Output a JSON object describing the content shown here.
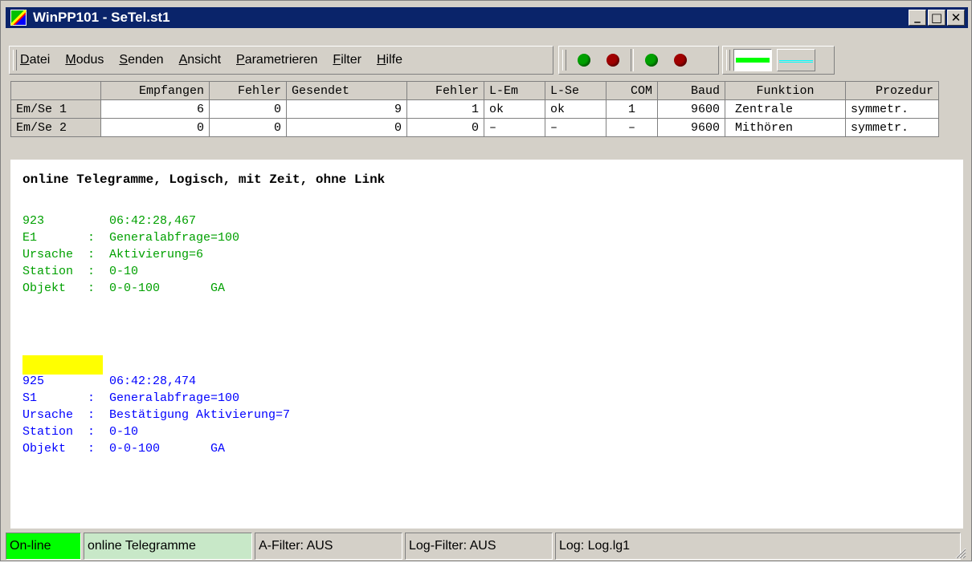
{
  "window": {
    "title": "WinPP101 - SeTel.st1",
    "buttons": [
      "_",
      "□",
      "✕"
    ]
  },
  "menu": {
    "items": [
      "Datei",
      "Modus",
      "Senden",
      "Ansicht",
      "Parametrieren",
      "Filter",
      "Hilfe"
    ]
  },
  "toolbar": {
    "leds": [
      "green",
      "red",
      "green",
      "red"
    ],
    "accent_colors": {
      "led_green": "#00a000",
      "led_red": "#a00000",
      "panel_green": "#00ff00",
      "panel_cyan": "#00ffff"
    }
  },
  "stats": {
    "headers": [
      "",
      "Empfangen",
      "Fehler",
      "Gesendet",
      "Fehler",
      "L-Em",
      "L-Se",
      "COM",
      "Baud",
      "Funktion",
      "Prozedur"
    ],
    "rows": [
      [
        "Em/Se 1",
        "6",
        "0",
        "9",
        "1",
        "ok",
        "ok",
        "1",
        "9600",
        "Zentrale",
        "symmetr."
      ],
      [
        "Em/Se 2",
        "0",
        "0",
        "0",
        "0",
        "–",
        "–",
        "–",
        "9600",
        "Mithören",
        "symmetr."
      ]
    ]
  },
  "content": {
    "heading": "online Telegramme, Logisch, mit Zeit, ohne Link",
    "telegram1": [
      "923         06:42:28,467",
      "E1       :  Generalabfrage=100",
      "Ursache  :  Aktivierung=6",
      "Station  :  0-10",
      "Objekt   :  0-0-100       GA"
    ],
    "telegram2": [
      "925         06:42:28,474",
      "S1       :  Generalabfrage=100",
      "Ursache  :  Bestätigung Aktivierung=7",
      "Station  :  0-10",
      "Objekt   :  0-0-100       GA"
    ]
  },
  "statusbar": {
    "online": "On-line",
    "mode": "online Telegramme",
    "a_filter": "A-Filter: AUS",
    "log_filter": "Log-Filter: AUS",
    "log": "Log: Log.lg1"
  }
}
